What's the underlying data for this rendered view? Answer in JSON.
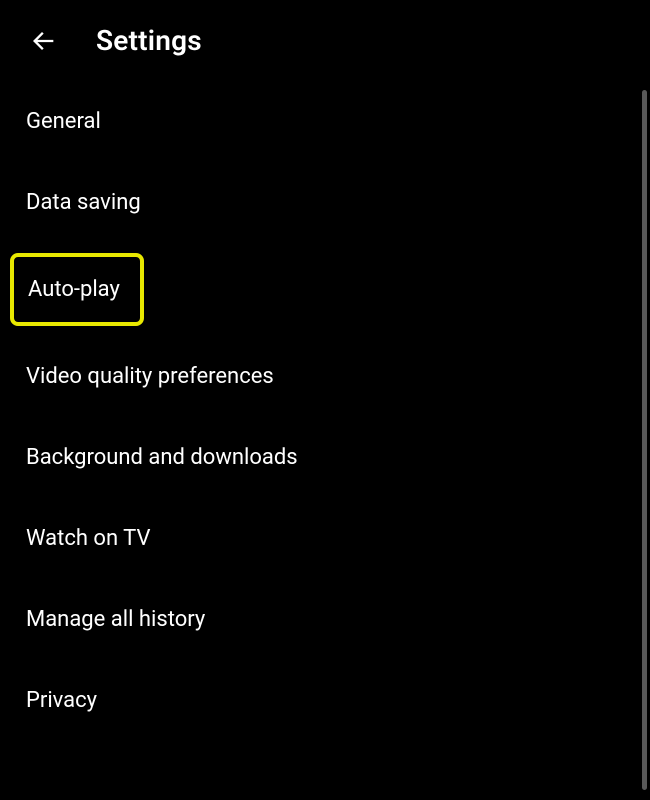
{
  "header": {
    "title": "Settings"
  },
  "settings": {
    "items": [
      {
        "label": "General"
      },
      {
        "label": "Data saving"
      },
      {
        "label": "Auto-play"
      },
      {
        "label": "Video quality preferences"
      },
      {
        "label": "Background and downloads"
      },
      {
        "label": "Watch on TV"
      },
      {
        "label": "Manage all history"
      },
      {
        "label": "Privacy"
      }
    ],
    "highlighted_index": 2,
    "highlight_color": "#e8e800"
  }
}
